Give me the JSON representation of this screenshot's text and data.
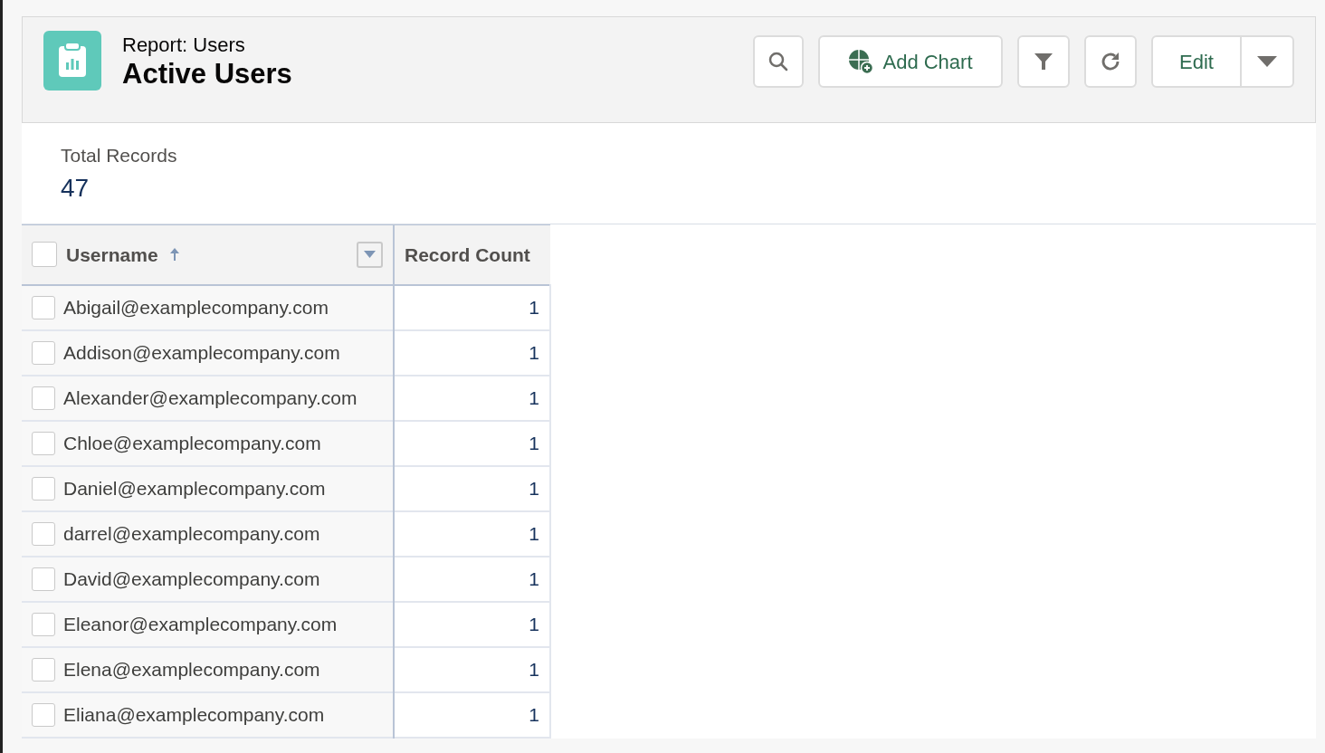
{
  "header": {
    "object_label": "Report: Users",
    "title": "Active Users"
  },
  "toolbar": {
    "add_chart": "Add Chart",
    "edit": "Edit"
  },
  "summary": {
    "label": "Total Records",
    "value": "47"
  },
  "table": {
    "select_all_checked": false,
    "columns": [
      {
        "label": "Username",
        "sort_ascending": true
      },
      {
        "label": "Record Count"
      }
    ],
    "rows": [
      {
        "checked": false,
        "username": "Abigail@examplecompany.com",
        "count": "1"
      },
      {
        "checked": false,
        "username": "Addison@examplecompany.com",
        "count": "1"
      },
      {
        "checked": false,
        "username": "Alexander@examplecompany.com",
        "count": "1"
      },
      {
        "checked": false,
        "username": "Chloe@examplecompany.com",
        "count": "1"
      },
      {
        "checked": false,
        "username": "Daniel@examplecompany.com",
        "count": "1"
      },
      {
        "checked": false,
        "username": "darrel@examplecompany.com",
        "count": "1"
      },
      {
        "checked": false,
        "username": "David@examplecompany.com",
        "count": "1"
      },
      {
        "checked": false,
        "username": "Eleanor@examplecompany.com",
        "count": "1"
      },
      {
        "checked": false,
        "username": "Elena@examplecompany.com",
        "count": "1"
      },
      {
        "checked": false,
        "username": "Eliana@examplecompany.com",
        "count": "1"
      }
    ]
  }
}
